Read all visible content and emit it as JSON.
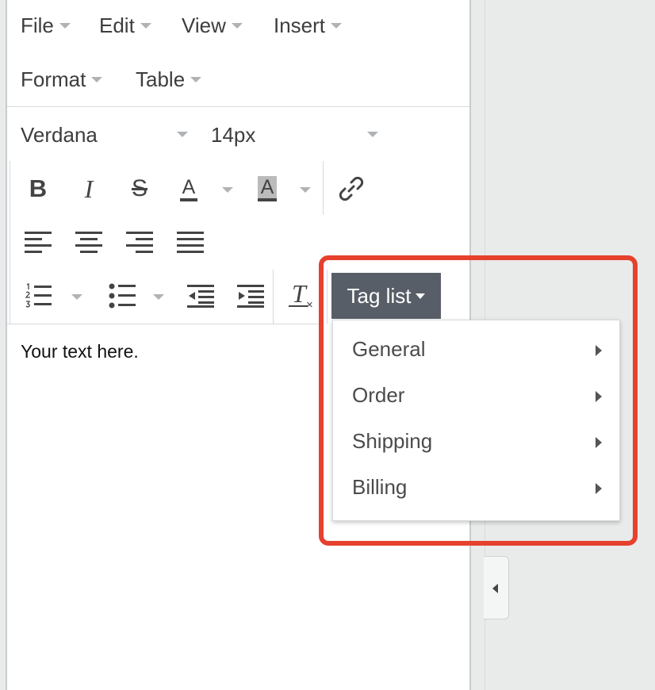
{
  "menubar": {
    "file": "File",
    "edit": "Edit",
    "view": "View",
    "insert": "Insert",
    "format": "Format",
    "table": "Table"
  },
  "font_family": {
    "selected": "Verdana"
  },
  "font_size": {
    "selected": "14px"
  },
  "toolbar": {
    "icons": [
      "bold-icon",
      "italic-icon",
      "strikethrough-icon",
      "text-color-icon",
      "background-color-icon",
      "link-icon",
      "align-left-icon",
      "align-center-icon",
      "align-right-icon",
      "align-justify-icon",
      "numbered-list-icon",
      "bulleted-list-icon",
      "outdent-icon",
      "indent-icon",
      "clear-formatting-icon"
    ],
    "bold_glyph": "B",
    "italic_glyph": "I",
    "strike_glyph": "S",
    "text_color_glyph": "A",
    "bg_color_glyph": "A",
    "clear_format_glyph": "T"
  },
  "tag_list": {
    "label": "Tag list",
    "items": [
      {
        "label": "General"
      },
      {
        "label": "Order"
      },
      {
        "label": "Shipping"
      },
      {
        "label": "Billing"
      }
    ]
  },
  "content": {
    "text": "Your text here."
  },
  "colors": {
    "highlight": "#e5412d",
    "tag_button": "#585e67"
  }
}
